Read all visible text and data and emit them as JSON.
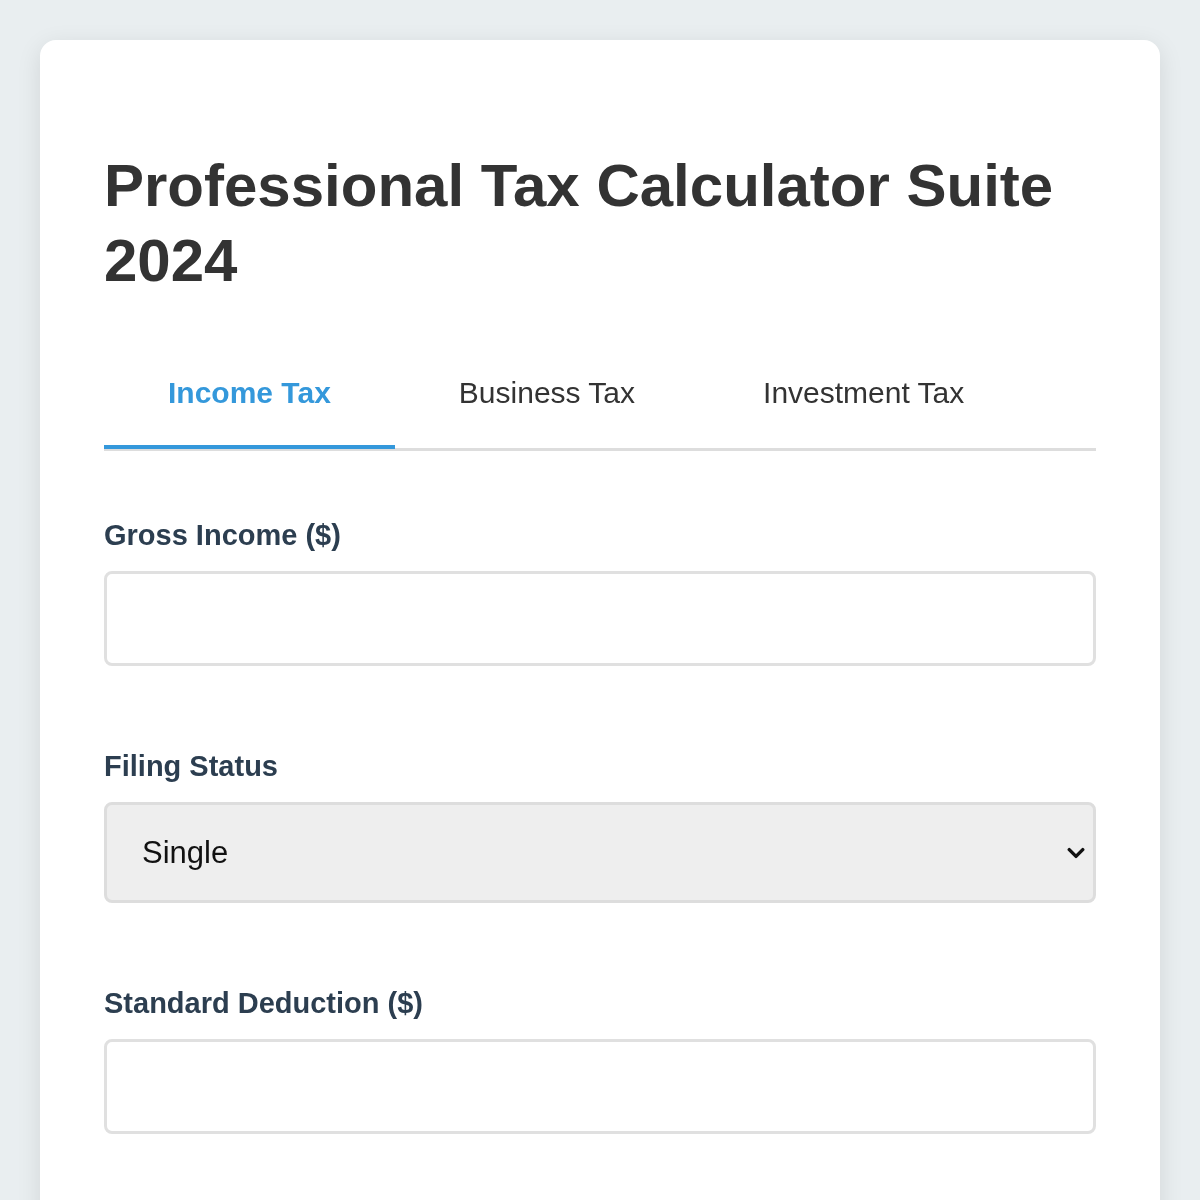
{
  "page": {
    "title": "Professional Tax Calculator Suite 2024"
  },
  "tabs": [
    {
      "label": "Income Tax",
      "selected": true
    },
    {
      "label": "Business Tax",
      "selected": false
    },
    {
      "label": "Investment Tax",
      "selected": false
    }
  ],
  "form": {
    "fields": [
      {
        "kind": "input",
        "label": "Gross Income ($)"
      },
      {
        "kind": "select",
        "label": "Filing Status",
        "value": "Single"
      },
      {
        "kind": "input",
        "label": "Standard Deduction ($)"
      }
    ]
  }
}
